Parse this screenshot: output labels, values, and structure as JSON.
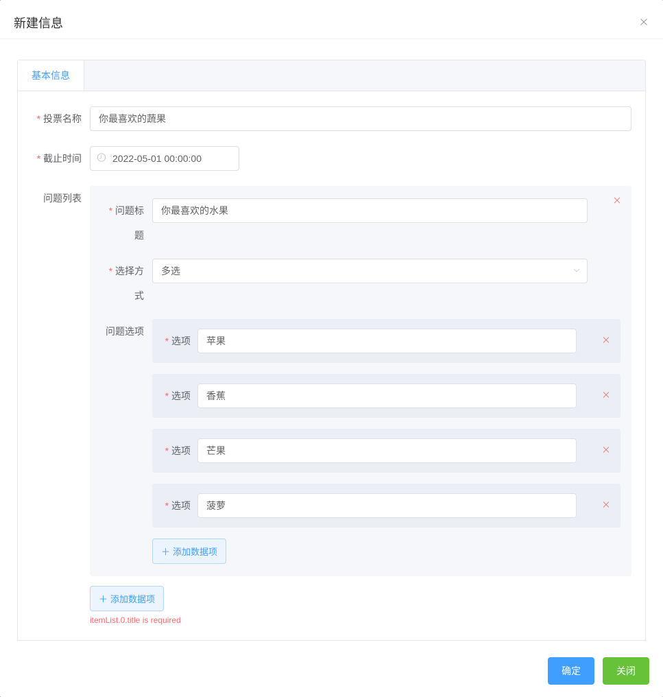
{
  "dialog": {
    "title": "新建信息"
  },
  "tabs": {
    "basic": "基本信息"
  },
  "form": {
    "voteNameLabel": "投票名称",
    "voteNameValue": "你最喜欢的蔬果",
    "deadlineLabel": "截止时间",
    "deadlineValue": "2022-05-01 00:00:00",
    "questionListLabel": "问题列表",
    "questionTitleLabel": "问题标题",
    "questionTitleValue": "你最喜欢的水果",
    "selectModeLabel": "选择方式",
    "selectModeValue": "多选",
    "questionOptionsLabel": "问题选项",
    "optionLabel": "选项",
    "options": {
      "0": "苹果",
      "1": "香蕉",
      "2": "芒果",
      "3": "菠萝"
    },
    "addOptionBtn": "添加数据项",
    "addQuestionBtn": "添加数据项",
    "errorText": "itemList.0.title is required"
  },
  "footer": {
    "confirm": "确定",
    "close": "关闭"
  }
}
